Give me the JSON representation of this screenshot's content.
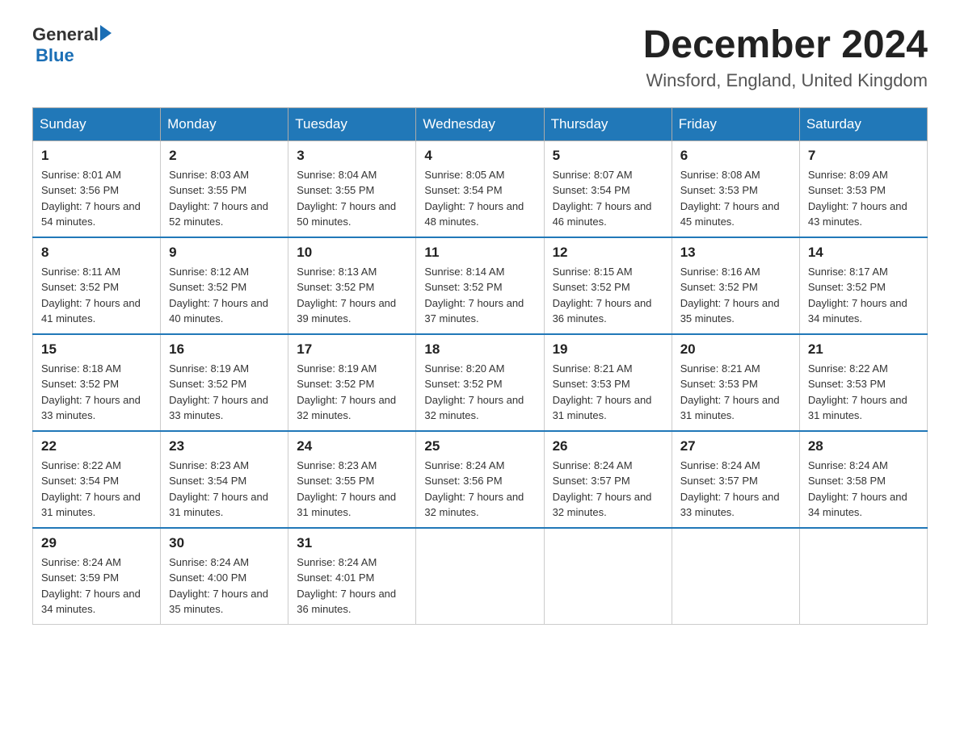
{
  "header": {
    "logo_general": "General",
    "logo_blue": "Blue",
    "month_title": "December 2024",
    "location": "Winsford, England, United Kingdom"
  },
  "weekdays": [
    "Sunday",
    "Monday",
    "Tuesday",
    "Wednesday",
    "Thursday",
    "Friday",
    "Saturday"
  ],
  "weeks": [
    [
      {
        "day": "1",
        "sunrise": "8:01 AM",
        "sunset": "3:56 PM",
        "daylight": "7 hours and 54 minutes."
      },
      {
        "day": "2",
        "sunrise": "8:03 AM",
        "sunset": "3:55 PM",
        "daylight": "7 hours and 52 minutes."
      },
      {
        "day": "3",
        "sunrise": "8:04 AM",
        "sunset": "3:55 PM",
        "daylight": "7 hours and 50 minutes."
      },
      {
        "day": "4",
        "sunrise": "8:05 AM",
        "sunset": "3:54 PM",
        "daylight": "7 hours and 48 minutes."
      },
      {
        "day": "5",
        "sunrise": "8:07 AM",
        "sunset": "3:54 PM",
        "daylight": "7 hours and 46 minutes."
      },
      {
        "day": "6",
        "sunrise": "8:08 AM",
        "sunset": "3:53 PM",
        "daylight": "7 hours and 45 minutes."
      },
      {
        "day": "7",
        "sunrise": "8:09 AM",
        "sunset": "3:53 PM",
        "daylight": "7 hours and 43 minutes."
      }
    ],
    [
      {
        "day": "8",
        "sunrise": "8:11 AM",
        "sunset": "3:52 PM",
        "daylight": "7 hours and 41 minutes."
      },
      {
        "day": "9",
        "sunrise": "8:12 AM",
        "sunset": "3:52 PM",
        "daylight": "7 hours and 40 minutes."
      },
      {
        "day": "10",
        "sunrise": "8:13 AM",
        "sunset": "3:52 PM",
        "daylight": "7 hours and 39 minutes."
      },
      {
        "day": "11",
        "sunrise": "8:14 AM",
        "sunset": "3:52 PM",
        "daylight": "7 hours and 37 minutes."
      },
      {
        "day": "12",
        "sunrise": "8:15 AM",
        "sunset": "3:52 PM",
        "daylight": "7 hours and 36 minutes."
      },
      {
        "day": "13",
        "sunrise": "8:16 AM",
        "sunset": "3:52 PM",
        "daylight": "7 hours and 35 minutes."
      },
      {
        "day": "14",
        "sunrise": "8:17 AM",
        "sunset": "3:52 PM",
        "daylight": "7 hours and 34 minutes."
      }
    ],
    [
      {
        "day": "15",
        "sunrise": "8:18 AM",
        "sunset": "3:52 PM",
        "daylight": "7 hours and 33 minutes."
      },
      {
        "day": "16",
        "sunrise": "8:19 AM",
        "sunset": "3:52 PM",
        "daylight": "7 hours and 33 minutes."
      },
      {
        "day": "17",
        "sunrise": "8:19 AM",
        "sunset": "3:52 PM",
        "daylight": "7 hours and 32 minutes."
      },
      {
        "day": "18",
        "sunrise": "8:20 AM",
        "sunset": "3:52 PM",
        "daylight": "7 hours and 32 minutes."
      },
      {
        "day": "19",
        "sunrise": "8:21 AM",
        "sunset": "3:53 PM",
        "daylight": "7 hours and 31 minutes."
      },
      {
        "day": "20",
        "sunrise": "8:21 AM",
        "sunset": "3:53 PM",
        "daylight": "7 hours and 31 minutes."
      },
      {
        "day": "21",
        "sunrise": "8:22 AM",
        "sunset": "3:53 PM",
        "daylight": "7 hours and 31 minutes."
      }
    ],
    [
      {
        "day": "22",
        "sunrise": "8:22 AM",
        "sunset": "3:54 PM",
        "daylight": "7 hours and 31 minutes."
      },
      {
        "day": "23",
        "sunrise": "8:23 AM",
        "sunset": "3:54 PM",
        "daylight": "7 hours and 31 minutes."
      },
      {
        "day": "24",
        "sunrise": "8:23 AM",
        "sunset": "3:55 PM",
        "daylight": "7 hours and 31 minutes."
      },
      {
        "day": "25",
        "sunrise": "8:24 AM",
        "sunset": "3:56 PM",
        "daylight": "7 hours and 32 minutes."
      },
      {
        "day": "26",
        "sunrise": "8:24 AM",
        "sunset": "3:57 PM",
        "daylight": "7 hours and 32 minutes."
      },
      {
        "day": "27",
        "sunrise": "8:24 AM",
        "sunset": "3:57 PM",
        "daylight": "7 hours and 33 minutes."
      },
      {
        "day": "28",
        "sunrise": "8:24 AM",
        "sunset": "3:58 PM",
        "daylight": "7 hours and 34 minutes."
      }
    ],
    [
      {
        "day": "29",
        "sunrise": "8:24 AM",
        "sunset": "3:59 PM",
        "daylight": "7 hours and 34 minutes."
      },
      {
        "day": "30",
        "sunrise": "8:24 AM",
        "sunset": "4:00 PM",
        "daylight": "7 hours and 35 minutes."
      },
      {
        "day": "31",
        "sunrise": "8:24 AM",
        "sunset": "4:01 PM",
        "daylight": "7 hours and 36 minutes."
      },
      null,
      null,
      null,
      null
    ]
  ]
}
